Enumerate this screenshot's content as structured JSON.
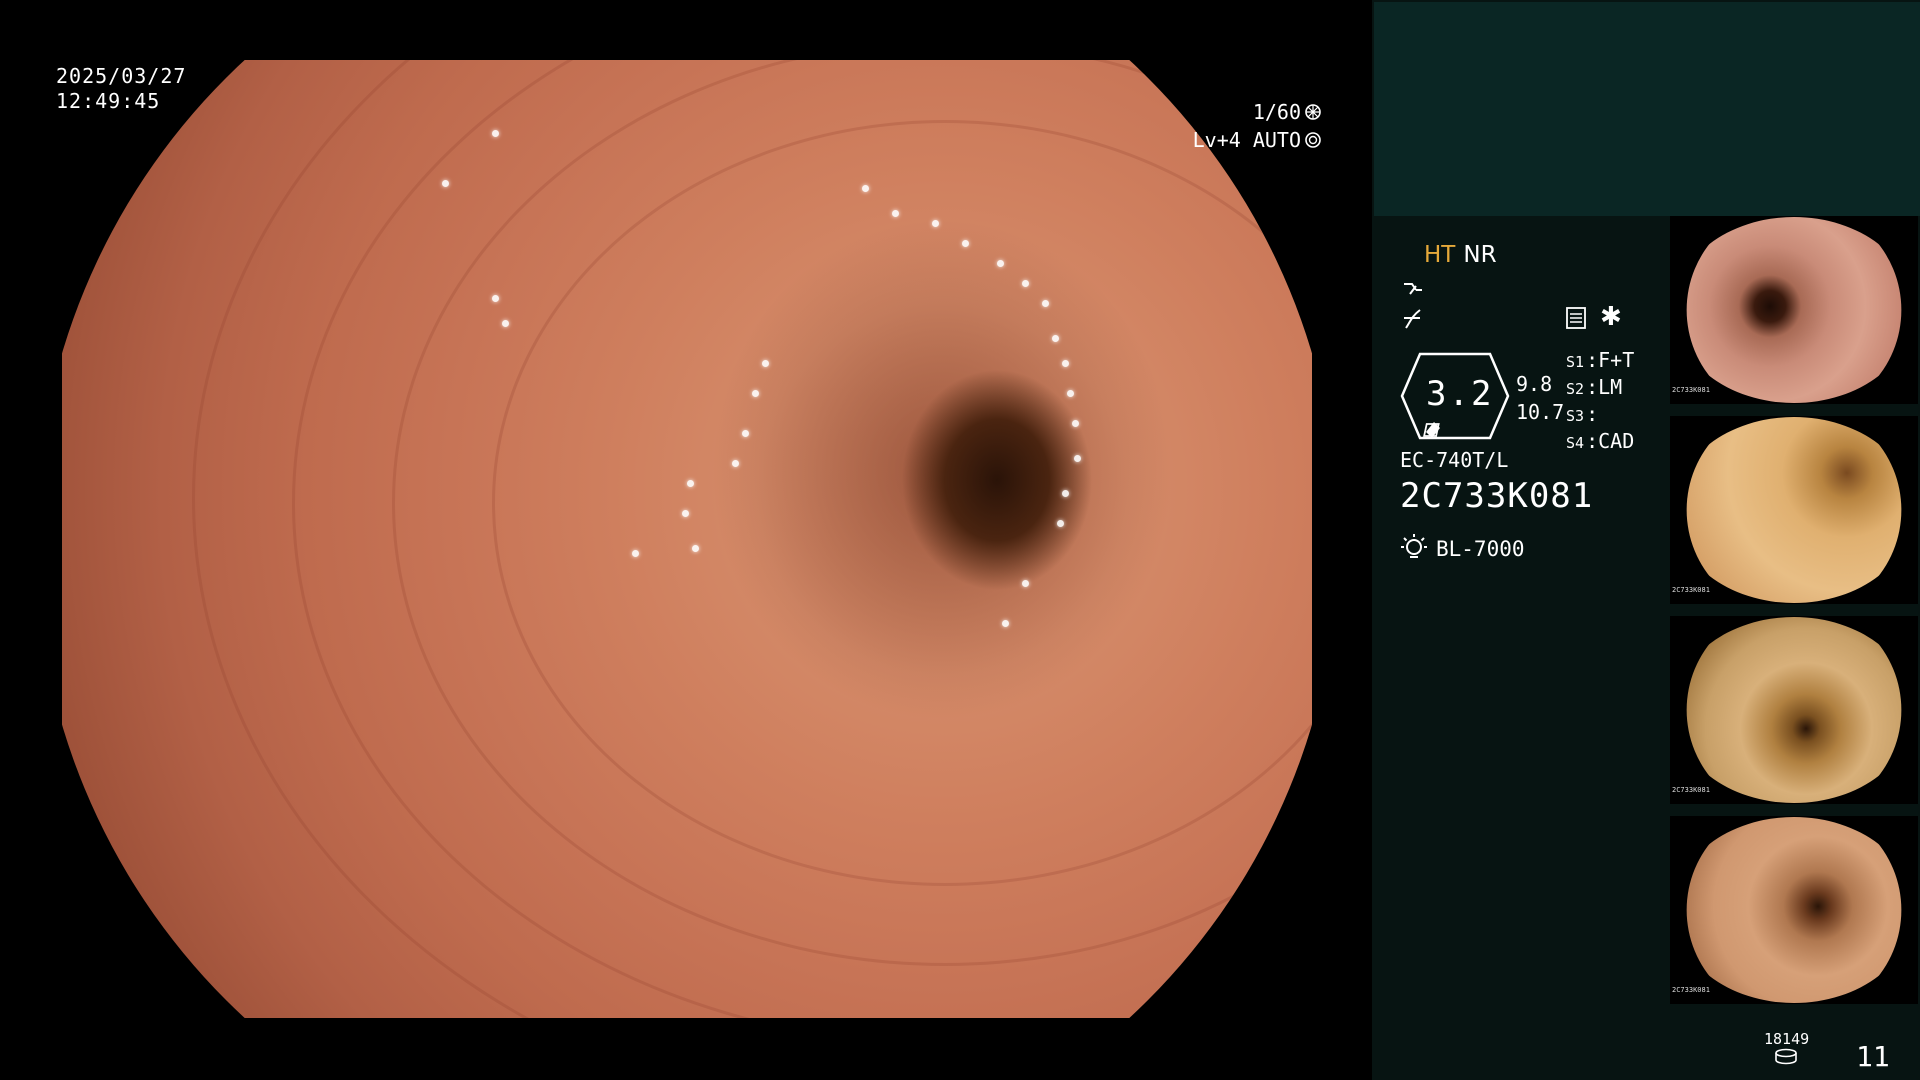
{
  "overlay": {
    "date": "2025/03/27",
    "time": "12:49:45",
    "shutter": "1/60",
    "level": "Lv+4 AUTO"
  },
  "panel": {
    "mode_ht": "HT",
    "mode_nr": "NR",
    "zoom": "3.2",
    "zoom_side_1": "9.8",
    "zoom_side_2": "10.7",
    "settings": [
      {
        "key": "S1",
        "value": "F+T"
      },
      {
        "key": "S2",
        "value": "LM"
      },
      {
        "key": "S3",
        "value": ""
      },
      {
        "key": "S4",
        "value": "CAD"
      }
    ],
    "scope_model": "EC-740T/L",
    "scope_serial": "2C733K081",
    "light_source": "BL-7000",
    "storage_count": "18149",
    "frame_count": "11"
  },
  "thumbnails": [
    {
      "serial": "2C733K081"
    },
    {
      "serial": "2C733K081"
    },
    {
      "serial": "2C733K081"
    },
    {
      "serial": "2C733K081"
    }
  ]
}
